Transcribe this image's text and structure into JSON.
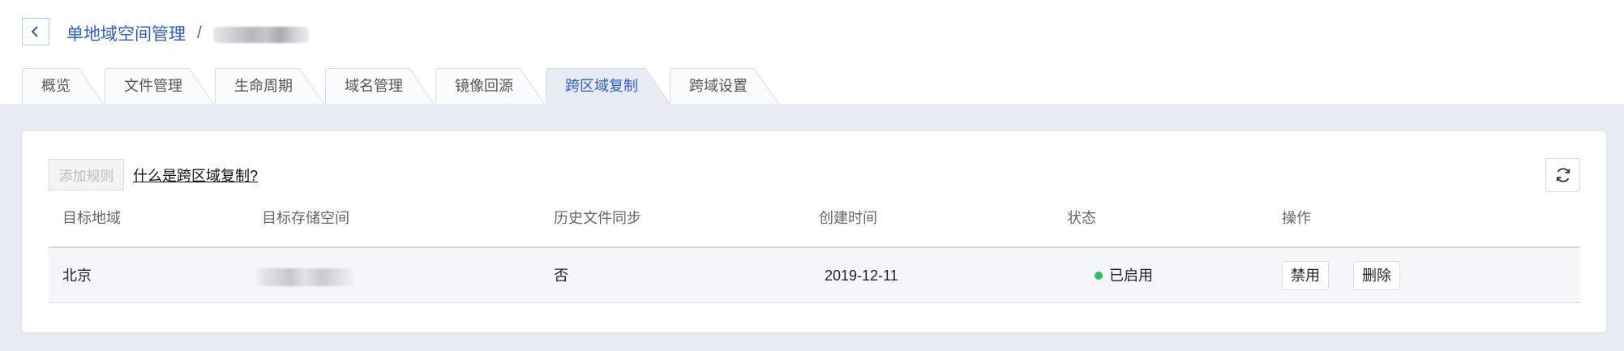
{
  "breadcrumb": {
    "title": "单地域空间管理",
    "separator": "/"
  },
  "tabs": [
    {
      "label": "概览"
    },
    {
      "label": "文件管理"
    },
    {
      "label": "生命周期"
    },
    {
      "label": "域名管理"
    },
    {
      "label": "镜像回源"
    },
    {
      "label": "跨区域复制"
    },
    {
      "label": "跨域设置"
    }
  ],
  "active_tab": "跨区域复制",
  "toolbar": {
    "add_rule_label": "添加规则",
    "help_link": "什么是跨区域复制?"
  },
  "table": {
    "columns": [
      "目标地域",
      "目标存储空间",
      "历史文件同步",
      "创建时间",
      "状态",
      "操作"
    ],
    "rows": [
      {
        "region": "北京",
        "history_sync": "否",
        "created": "2019-12-11",
        "status": "已启用",
        "actions": [
          "禁用",
          "删除"
        ]
      }
    ]
  },
  "colors": {
    "accent": "#2b5ed9",
    "status_enabled": "#2fc25b",
    "content_background": "#e9ebf3"
  },
  "icons": {
    "back": "chevron-left-icon",
    "refresh": "refresh-icon"
  }
}
